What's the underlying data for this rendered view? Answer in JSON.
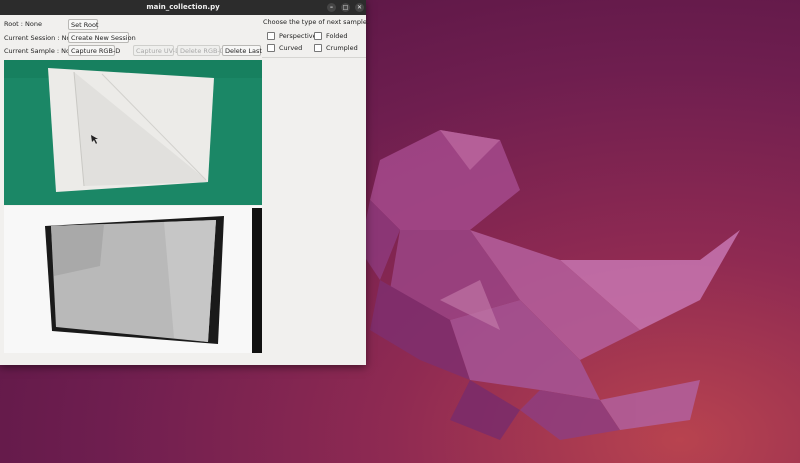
{
  "window": {
    "title": "main_collection.py"
  },
  "controls": {
    "root_label": "Root : None",
    "set_root": "Set Root",
    "session_label": "Current Session : None",
    "create_session": "Create New Session",
    "sample_label": "Current Sample : None",
    "capture_rgbd": "Capture RGB-D",
    "capture_uvd": "Capture UV-D",
    "delete_rgbd": "Delete RGB-D",
    "delete_last": "Delete Last"
  },
  "sample_type": {
    "prompt": "Choose the type of next sample.",
    "options": [
      {
        "label": "Perspective",
        "checked": false
      },
      {
        "label": "Folded",
        "checked": false
      },
      {
        "label": "Curved",
        "checked": false
      },
      {
        "label": "Crumpled",
        "checked": false
      }
    ]
  },
  "colors": {
    "rgb_background": "#1c8a68",
    "paper": "#e8e8e6",
    "depth_object": "#b8b8b8"
  }
}
